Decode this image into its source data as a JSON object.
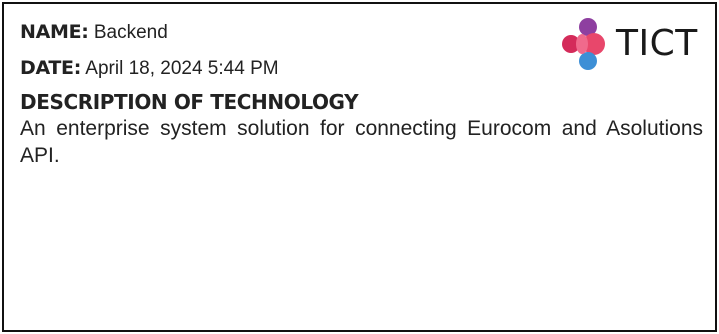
{
  "record": {
    "name_label": "NAME:",
    "name_value": "Backend",
    "date_label": "DATE:",
    "date_value": "April 18, 2024 5:44 PM",
    "description_heading": "DESCRIPTION OF TECHNOLOGY",
    "description_text": "An enterprise system solution for connecting Eurocom and Asolutions API."
  },
  "logo": {
    "text": "TICT",
    "icon": "tict-logo-mark",
    "colors": {
      "top": "#8e3fa0",
      "left": "#d42b5a",
      "right": "#e8476b",
      "bottom": "#3d8fd6",
      "center": "#f06a8c"
    }
  }
}
